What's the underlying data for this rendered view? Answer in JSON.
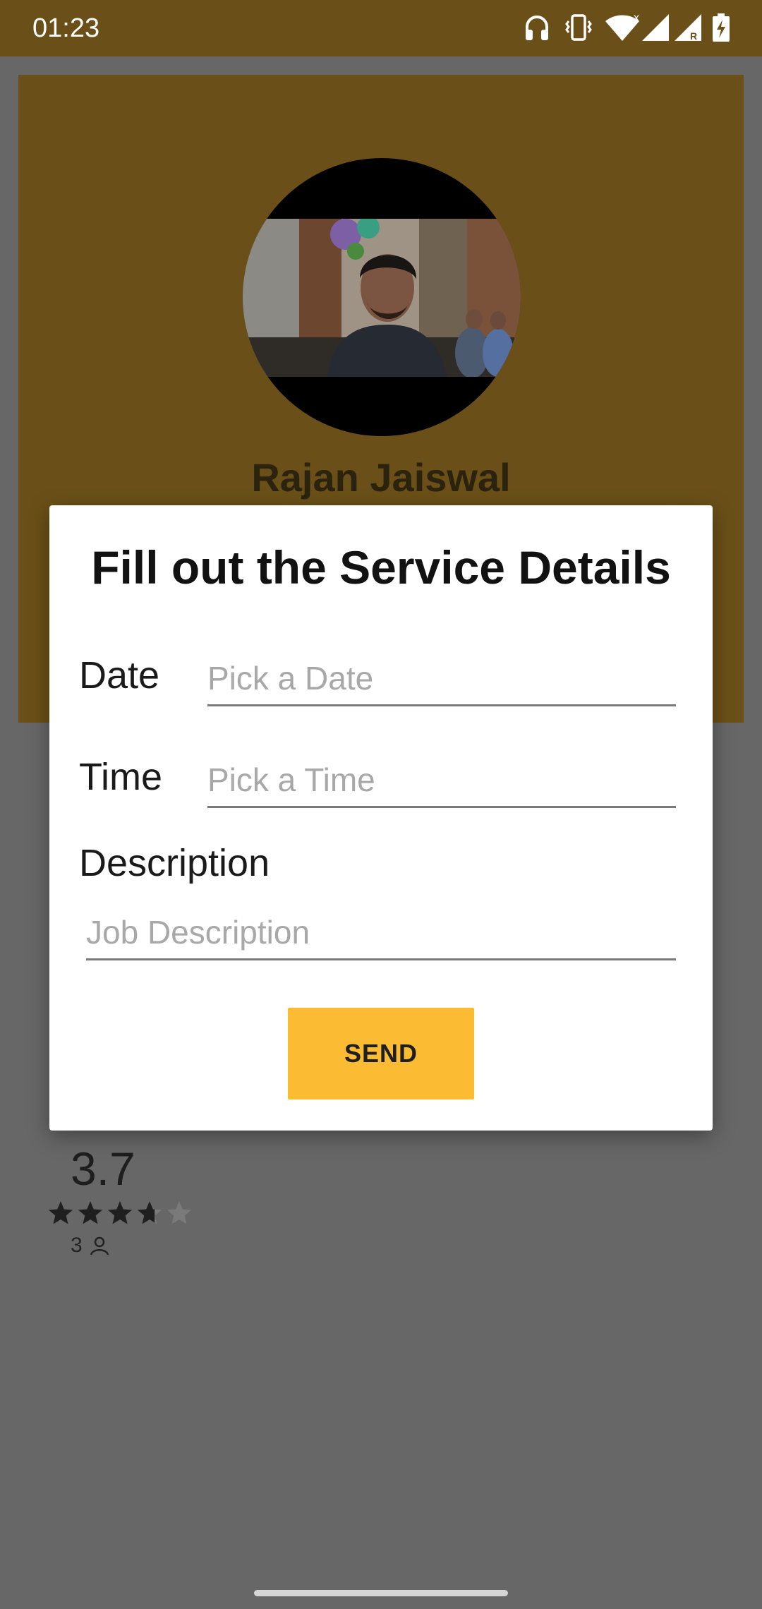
{
  "status_bar": {
    "time": "01:23",
    "icons": [
      "headphones-icon",
      "vibrate-icon",
      "wifi-icon",
      "signal-icon",
      "signal-roaming-icon",
      "battery-charging-icon"
    ]
  },
  "profile": {
    "name": "Rajan Jaiswal"
  },
  "rating": {
    "value": "3.7",
    "stars": 3.7,
    "max_stars": 5,
    "count": "3"
  },
  "dialog": {
    "title": "Fill out the Service Details",
    "date": {
      "label": "Date",
      "placeholder": "Pick a Date",
      "value": ""
    },
    "time": {
      "label": "Time",
      "placeholder": "Pick a Time",
      "value": ""
    },
    "description": {
      "label": "Description",
      "placeholder": "Job Description",
      "value": ""
    },
    "send_label": "SEND"
  },
  "colors": {
    "status_bar": "#6a5018",
    "card_dimmed": "#6a5018",
    "scrim_background": "#676767",
    "send_button": "#fbbc34",
    "dialog_background": "#ffffff"
  }
}
